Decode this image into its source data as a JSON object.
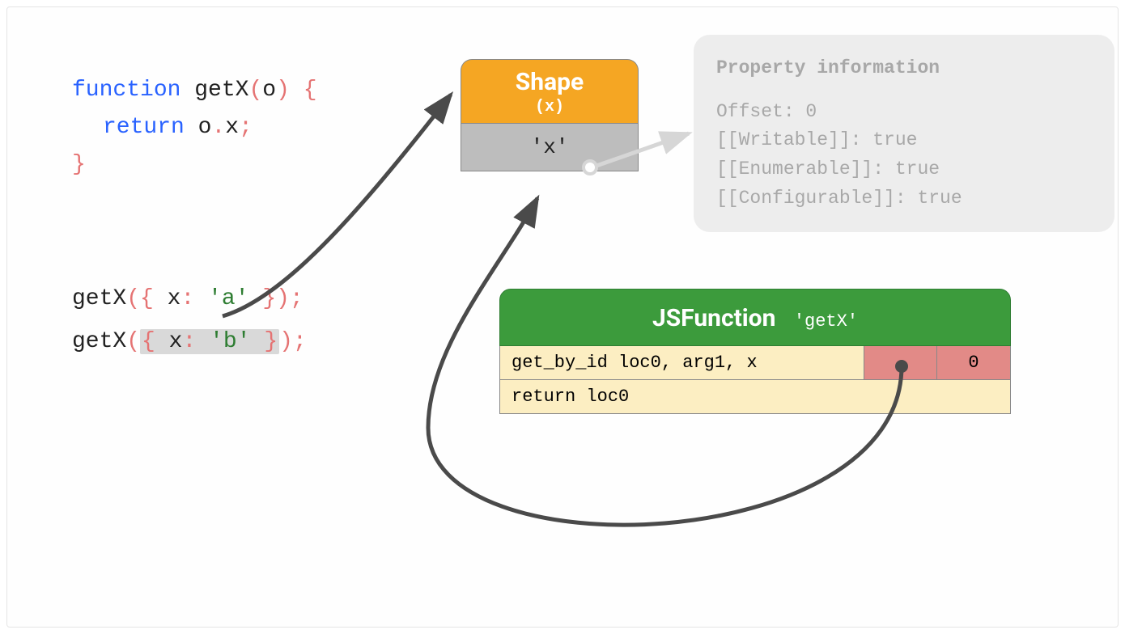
{
  "code": {
    "kw_function": "function",
    "fn_name": "getX",
    "param": "o",
    "kw_return": "return",
    "return_obj": "o",
    "return_prop": "x"
  },
  "calls": {
    "fn": "getX",
    "line1": {
      "key": "x",
      "val": "'a'"
    },
    "line2": {
      "key": "x",
      "val": "'b'"
    }
  },
  "shape": {
    "title": "Shape",
    "sub": "(x)",
    "prop": "'x'"
  },
  "prop_info": {
    "title": "Property information",
    "offset": "Offset: 0",
    "writable": "[[Writable]]: true",
    "enumerable": "[[Enumerable]]: true",
    "configurable": "[[Configurable]]: true"
  },
  "jsfunc": {
    "title": "JSFunction",
    "name": "'getX'",
    "bytecode": {
      "line1": "get_by_id loc0, arg1, x",
      "line2": "return loc0",
      "cache_val": "0"
    }
  }
}
